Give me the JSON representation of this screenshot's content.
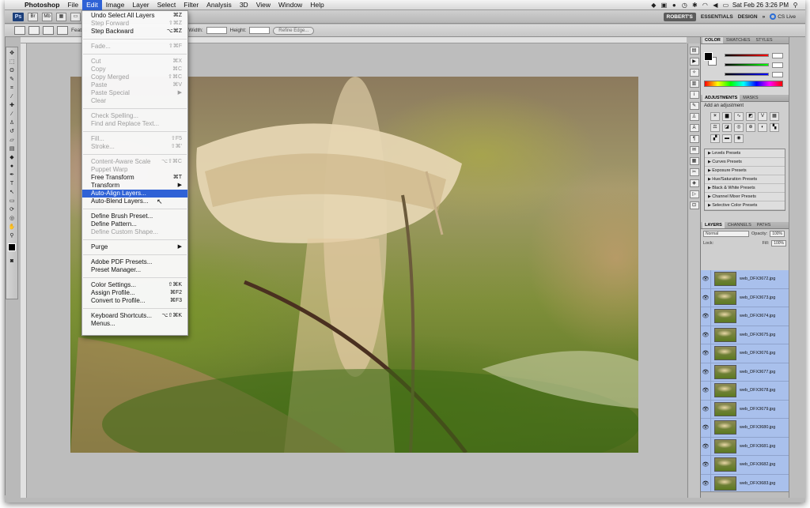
{
  "menubar": {
    "apple": "",
    "items": [
      "Photoshop",
      "File",
      "Edit",
      "Image",
      "Layer",
      "Select",
      "Filter",
      "Analysis",
      "3D",
      "View",
      "Window",
      "Help"
    ],
    "clock": "Sat Feb 26  3:26 PM"
  },
  "appbar": {
    "ps_logo": "Ps",
    "workspace_current": "ROBERT'S",
    "workspace_essentials": "ESSENTIALS",
    "workspace_design": "DESIGN",
    "more": "»",
    "cs_live": "CS Live"
  },
  "options": {
    "feather": "Feathe",
    "width": "Width:",
    "height": "Height:",
    "refine": "Refine Edge..."
  },
  "edit_menu": {
    "items": [
      {
        "label": "Undo Select All Layers",
        "shortcut": "⌘Z",
        "enabled": true
      },
      {
        "label": "Step Forward",
        "shortcut": "⇧⌘Z",
        "enabled": false
      },
      {
        "label": "Step Backward",
        "shortcut": "⌥⌘Z",
        "enabled": true
      },
      {
        "sep": true
      },
      {
        "label": "Fade...",
        "shortcut": "⇧⌘F",
        "enabled": false
      },
      {
        "sep": true
      },
      {
        "label": "Cut",
        "shortcut": "⌘X",
        "enabled": false
      },
      {
        "label": "Copy",
        "shortcut": "⌘C",
        "enabled": false
      },
      {
        "label": "Copy Merged",
        "shortcut": "⇧⌘C",
        "enabled": false
      },
      {
        "label": "Paste",
        "shortcut": "⌘V",
        "enabled": false
      },
      {
        "label": "Paste Special",
        "shortcut": "▶",
        "enabled": false
      },
      {
        "label": "Clear",
        "shortcut": "",
        "enabled": false
      },
      {
        "sep": true
      },
      {
        "label": "Check Spelling...",
        "shortcut": "",
        "enabled": false
      },
      {
        "label": "Find and Replace Text...",
        "shortcut": "",
        "enabled": false
      },
      {
        "sep": true
      },
      {
        "label": "Fill...",
        "shortcut": "⇧F5",
        "enabled": false
      },
      {
        "label": "Stroke...",
        "shortcut": "⇧⌘'",
        "enabled": false
      },
      {
        "sep": true
      },
      {
        "label": "Content-Aware Scale",
        "shortcut": "⌥⇧⌘C",
        "enabled": false
      },
      {
        "label": "Puppet Warp",
        "shortcut": "",
        "enabled": false
      },
      {
        "label": "Free Transform",
        "shortcut": "⌘T",
        "enabled": true
      },
      {
        "label": "Transform",
        "shortcut": "▶",
        "enabled": true
      },
      {
        "label": "Auto-Align Layers...",
        "shortcut": "",
        "enabled": true,
        "highlight": true
      },
      {
        "label": "Auto-Blend Layers...",
        "shortcut": "",
        "enabled": true
      },
      {
        "sep": true
      },
      {
        "label": "Define Brush Preset...",
        "shortcut": "",
        "enabled": true
      },
      {
        "label": "Define Pattern...",
        "shortcut": "",
        "enabled": true
      },
      {
        "label": "Define Custom Shape...",
        "shortcut": "",
        "enabled": false
      },
      {
        "sep": true
      },
      {
        "label": "Purge",
        "shortcut": "▶",
        "enabled": true
      },
      {
        "sep": true
      },
      {
        "label": "Adobe PDF Presets...",
        "shortcut": "",
        "enabled": true
      },
      {
        "label": "Preset Manager...",
        "shortcut": "",
        "enabled": true
      },
      {
        "sep": true
      },
      {
        "label": "Color Settings...",
        "shortcut": "⇧⌘K",
        "enabled": true
      },
      {
        "label": "Assign Profile...",
        "shortcut": "⌘F2",
        "enabled": true
      },
      {
        "label": "Convert to Profile...",
        "shortcut": "⌘F3",
        "enabled": true
      },
      {
        "sep": true
      },
      {
        "label": "Keyboard Shortcuts...",
        "shortcut": "⌥⇧⌘K",
        "enabled": true
      },
      {
        "label": "Menus...",
        "shortcut": "",
        "enabled": true
      }
    ]
  },
  "panels": {
    "color_tabs": [
      "COLOR",
      "SWATCHES",
      "STYLES"
    ],
    "adjust_tabs": [
      "ADJUSTMENTS",
      "MASKS"
    ],
    "adjust_title": "Add an adjustment",
    "presets": [
      "Levels Presets",
      "Curves Presets",
      "Exposure Presets",
      "Hue/Saturation Presets",
      "Black & White Presets",
      "Channel Mixer Presets",
      "Selective Color Presets"
    ],
    "layer_tabs": [
      "LAYERS",
      "CHANNELS",
      "PATHS"
    ],
    "blend_mode": "Normal",
    "opacity_label": "Opacity:",
    "opacity": "100%",
    "fill_label": "Fill:",
    "fill": "100%",
    "lock_label": "Lock:",
    "layers": [
      "web_DFX3672.jpg",
      "web_DFX3673.jpg",
      "web_DFX3674.jpg",
      "web_DFX3675.jpg",
      "web_DFX3676.jpg",
      "web_DFX3677.jpg",
      "web_DFX3678.jpg",
      "web_DFX3679.jpg",
      "web_DFX3680.jpg",
      "web_DFX3681.jpg",
      "web_DFX3682.jpg",
      "web_DFX3683.jpg"
    ]
  },
  "colors": {
    "menu_highlight": "#2f62d6",
    "layer_selected": "#a9c0ec"
  }
}
